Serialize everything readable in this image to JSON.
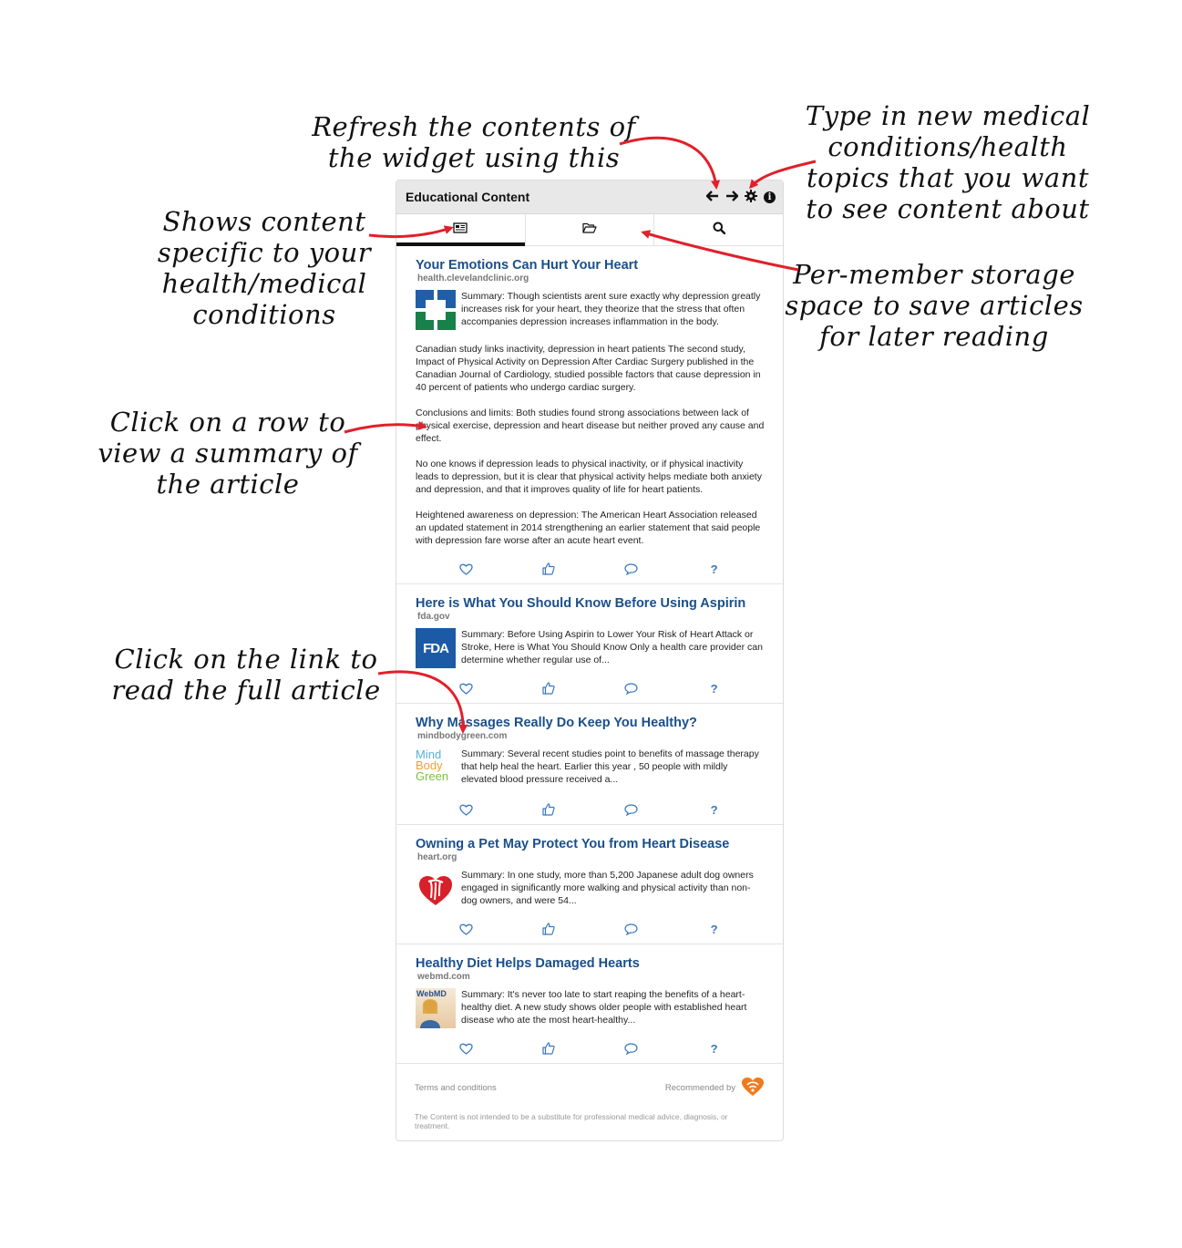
{
  "annotations": {
    "refresh": "Refresh the contents of\nthe widget using this",
    "type_in": "Type in new medical\nconditions/health\ntopics that you want\nto see content about",
    "shows": "Shows content\nspecific to your\nhealth/medical\nconditions",
    "storage": "Per-member storage\nspace to save articles\nfor later reading",
    "click_row": "Click on a row to\nview a summary of\nthe article",
    "click_link": "Click on the link to\nread the full article"
  },
  "widget": {
    "title": "Educational Content",
    "header_icons": [
      "arrow-left-icon",
      "arrow-right-icon",
      "gear-icon",
      "info-icon"
    ],
    "info_glyph": "i",
    "tabs": [
      {
        "icon": "newspaper-icon",
        "active": true
      },
      {
        "icon": "folder-open-icon",
        "active": false
      },
      {
        "icon": "search-icon",
        "active": false
      }
    ]
  },
  "articles": [
    {
      "title": "Your Emotions Can Hurt Your Heart",
      "source": "health.clevelandclinic.org",
      "logo": "cleveland-clinic-logo",
      "summary": "Summary: Though scientists arent sure exactly why depression greatly increases risk for your heart, they theorize that the stress that often accompanies depression increases inflammation in the body.",
      "expanded": [
        "Canadian study links inactivity, depression in heart patients The second study, Impact of Physical Activity on Depression After Cardiac Surgery published in the Canadian Journal of Cardiology, studied possible factors that cause depression in 40 percent of patients who undergo cardiac surgery.",
        "Conclusions and limits: Both studies found strong associations between lack of physical exercise, depression and heart disease but neither proved any cause and effect.",
        "No one knows if depression leads to physical inactivity, or if physical inactivity leads to depression, but it is clear that physical activity helps mediate both anxiety and depression, and that it improves quality of life for heart patients.",
        "Heightened awareness on depression: The American Heart Association released an updated statement in 2014 strengthening an earlier statement that said people with depression fare worse after an acute heart event."
      ]
    },
    {
      "title": "Here is What You Should Know Before Using Aspirin",
      "source": "fda.gov",
      "logo": "fda-logo",
      "logo_text": "FDA",
      "summary": "Summary: Before Using Aspirin to Lower Your Risk of Heart Attack or Stroke, Here is What You Should Know Only a health care provider can determine whether regular use of..."
    },
    {
      "title": "Why Massages Really Do Keep You Healthy?",
      "source": "mindbodygreen.com",
      "logo": "mindbodygreen-logo",
      "logo_words": [
        "Mind",
        "Body",
        "Green"
      ],
      "summary": "Summary: Several recent studies point to benefits of massage therapy that help heal the heart. Earlier this year , 50 people with mildly elevated blood pressure received a..."
    },
    {
      "title": "Owning a Pet May Protect You from Heart Disease",
      "source": "heart.org",
      "logo": "american-heart-association-logo",
      "summary": "Summary: In one study, more than 5,200 Japanese adult dog owners engaged in significantly more walking and physical activity than non-dog owners, and were 54..."
    },
    {
      "title": "Healthy Diet Helps Damaged Hearts",
      "source": "webmd.com",
      "logo": "webmd-magazine-logo",
      "logo_text": "WebMD",
      "summary": "Summary: It's never too late to start reaping the benefits of a heart-healthy diet. A new study shows older people with established heart disease who ate the most heart-healthy..."
    }
  ],
  "article_actions": [
    "heart-icon",
    "thumbs-up-icon",
    "comment-icon",
    "question-icon"
  ],
  "question_glyph": "?",
  "footer": {
    "terms": "Terms and conditions",
    "recommended": "Recommended by",
    "disclaimer": "The Content is not intended to be a substitute for professional medical advice, diagnosis, or treatment."
  },
  "colors": {
    "title_link": "#1a4f8b",
    "action_icon": "#3a78c0",
    "arrow": "#e0202a",
    "header_bg": "#e8e8e8"
  }
}
